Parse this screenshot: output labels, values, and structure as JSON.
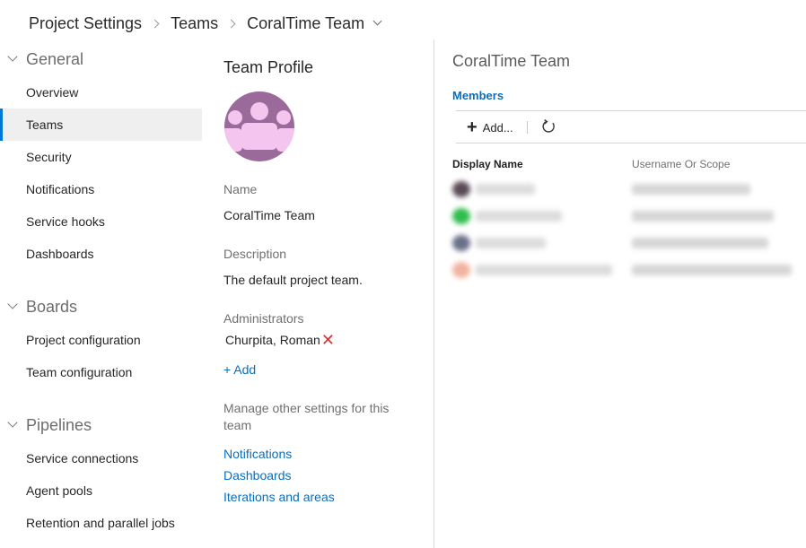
{
  "breadcrumb": {
    "items": [
      "Project Settings",
      "Teams",
      "CoralTime Team"
    ]
  },
  "sidebar": {
    "groups": [
      {
        "label": "General",
        "items": [
          {
            "label": "Overview"
          },
          {
            "label": "Teams",
            "active": true
          },
          {
            "label": "Security"
          },
          {
            "label": "Notifications"
          },
          {
            "label": "Service hooks"
          },
          {
            "label": "Dashboards"
          }
        ]
      },
      {
        "label": "Boards",
        "items": [
          {
            "label": "Project configuration"
          },
          {
            "label": "Team configuration"
          }
        ]
      },
      {
        "label": "Pipelines",
        "items": [
          {
            "label": "Service connections"
          },
          {
            "label": "Agent pools"
          },
          {
            "label": "Retention and parallel jobs"
          }
        ]
      }
    ]
  },
  "profile": {
    "title": "Team Profile",
    "avatar_icon": "team-avatar-icon",
    "name_label": "Name",
    "name_value": "CoralTime Team",
    "description_label": "Description",
    "description_value": "The default project team.",
    "administrators_label": "Administrators",
    "administrator": "Churpita, Roman",
    "remove_icon": "close-icon",
    "add_label": "+ Add",
    "manage_text": "Manage other settings for this team",
    "links": [
      "Notifications",
      "Dashboards",
      "Iterations and areas"
    ]
  },
  "members_panel": {
    "team_title": "CoralTime Team",
    "tab_label": "Members",
    "add_button": "Add...",
    "refresh_icon": "refresh-icon",
    "columns": [
      "Display Name",
      "Username Or Scope"
    ]
  },
  "colors": {
    "accent": "#0078d4",
    "link": "#0a6ebd",
    "avatar_bg": "#9a6b9a",
    "avatar_fg": "#f4c6ef",
    "remove": "#d13438"
  }
}
